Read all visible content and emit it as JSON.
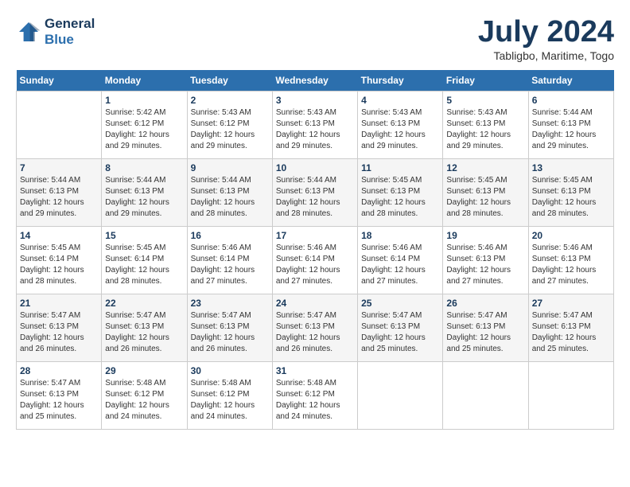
{
  "header": {
    "logo_line1": "General",
    "logo_line2": "Blue",
    "month_year": "July 2024",
    "location": "Tabligbo, Maritime, Togo"
  },
  "weekdays": [
    "Sunday",
    "Monday",
    "Tuesday",
    "Wednesday",
    "Thursday",
    "Friday",
    "Saturday"
  ],
  "weeks": [
    [
      {
        "day": "",
        "sunrise": "",
        "sunset": "",
        "daylight": ""
      },
      {
        "day": "1",
        "sunrise": "Sunrise: 5:42 AM",
        "sunset": "Sunset: 6:12 PM",
        "daylight": "Daylight: 12 hours and 29 minutes."
      },
      {
        "day": "2",
        "sunrise": "Sunrise: 5:43 AM",
        "sunset": "Sunset: 6:12 PM",
        "daylight": "Daylight: 12 hours and 29 minutes."
      },
      {
        "day": "3",
        "sunrise": "Sunrise: 5:43 AM",
        "sunset": "Sunset: 6:13 PM",
        "daylight": "Daylight: 12 hours and 29 minutes."
      },
      {
        "day": "4",
        "sunrise": "Sunrise: 5:43 AM",
        "sunset": "Sunset: 6:13 PM",
        "daylight": "Daylight: 12 hours and 29 minutes."
      },
      {
        "day": "5",
        "sunrise": "Sunrise: 5:43 AM",
        "sunset": "Sunset: 6:13 PM",
        "daylight": "Daylight: 12 hours and 29 minutes."
      },
      {
        "day": "6",
        "sunrise": "Sunrise: 5:44 AM",
        "sunset": "Sunset: 6:13 PM",
        "daylight": "Daylight: 12 hours and 29 minutes."
      }
    ],
    [
      {
        "day": "7",
        "sunrise": "Sunrise: 5:44 AM",
        "sunset": "Sunset: 6:13 PM",
        "daylight": "Daylight: 12 hours and 29 minutes."
      },
      {
        "day": "8",
        "sunrise": "Sunrise: 5:44 AM",
        "sunset": "Sunset: 6:13 PM",
        "daylight": "Daylight: 12 hours and 29 minutes."
      },
      {
        "day": "9",
        "sunrise": "Sunrise: 5:44 AM",
        "sunset": "Sunset: 6:13 PM",
        "daylight": "Daylight: 12 hours and 28 minutes."
      },
      {
        "day": "10",
        "sunrise": "Sunrise: 5:44 AM",
        "sunset": "Sunset: 6:13 PM",
        "daylight": "Daylight: 12 hours and 28 minutes."
      },
      {
        "day": "11",
        "sunrise": "Sunrise: 5:45 AM",
        "sunset": "Sunset: 6:13 PM",
        "daylight": "Daylight: 12 hours and 28 minutes."
      },
      {
        "day": "12",
        "sunrise": "Sunrise: 5:45 AM",
        "sunset": "Sunset: 6:13 PM",
        "daylight": "Daylight: 12 hours and 28 minutes."
      },
      {
        "day": "13",
        "sunrise": "Sunrise: 5:45 AM",
        "sunset": "Sunset: 6:13 PM",
        "daylight": "Daylight: 12 hours and 28 minutes."
      }
    ],
    [
      {
        "day": "14",
        "sunrise": "Sunrise: 5:45 AM",
        "sunset": "Sunset: 6:14 PM",
        "daylight": "Daylight: 12 hours and 28 minutes."
      },
      {
        "day": "15",
        "sunrise": "Sunrise: 5:45 AM",
        "sunset": "Sunset: 6:14 PM",
        "daylight": "Daylight: 12 hours and 28 minutes."
      },
      {
        "day": "16",
        "sunrise": "Sunrise: 5:46 AM",
        "sunset": "Sunset: 6:14 PM",
        "daylight": "Daylight: 12 hours and 27 minutes."
      },
      {
        "day": "17",
        "sunrise": "Sunrise: 5:46 AM",
        "sunset": "Sunset: 6:14 PM",
        "daylight": "Daylight: 12 hours and 27 minutes."
      },
      {
        "day": "18",
        "sunrise": "Sunrise: 5:46 AM",
        "sunset": "Sunset: 6:14 PM",
        "daylight": "Daylight: 12 hours and 27 minutes."
      },
      {
        "day": "19",
        "sunrise": "Sunrise: 5:46 AM",
        "sunset": "Sunset: 6:13 PM",
        "daylight": "Daylight: 12 hours and 27 minutes."
      },
      {
        "day": "20",
        "sunrise": "Sunrise: 5:46 AM",
        "sunset": "Sunset: 6:13 PM",
        "daylight": "Daylight: 12 hours and 27 minutes."
      }
    ],
    [
      {
        "day": "21",
        "sunrise": "Sunrise: 5:47 AM",
        "sunset": "Sunset: 6:13 PM",
        "daylight": "Daylight: 12 hours and 26 minutes."
      },
      {
        "day": "22",
        "sunrise": "Sunrise: 5:47 AM",
        "sunset": "Sunset: 6:13 PM",
        "daylight": "Daylight: 12 hours and 26 minutes."
      },
      {
        "day": "23",
        "sunrise": "Sunrise: 5:47 AM",
        "sunset": "Sunset: 6:13 PM",
        "daylight": "Daylight: 12 hours and 26 minutes."
      },
      {
        "day": "24",
        "sunrise": "Sunrise: 5:47 AM",
        "sunset": "Sunset: 6:13 PM",
        "daylight": "Daylight: 12 hours and 26 minutes."
      },
      {
        "day": "25",
        "sunrise": "Sunrise: 5:47 AM",
        "sunset": "Sunset: 6:13 PM",
        "daylight": "Daylight: 12 hours and 25 minutes."
      },
      {
        "day": "26",
        "sunrise": "Sunrise: 5:47 AM",
        "sunset": "Sunset: 6:13 PM",
        "daylight": "Daylight: 12 hours and 25 minutes."
      },
      {
        "day": "27",
        "sunrise": "Sunrise: 5:47 AM",
        "sunset": "Sunset: 6:13 PM",
        "daylight": "Daylight: 12 hours and 25 minutes."
      }
    ],
    [
      {
        "day": "28",
        "sunrise": "Sunrise: 5:47 AM",
        "sunset": "Sunset: 6:13 PM",
        "daylight": "Daylight: 12 hours and 25 minutes."
      },
      {
        "day": "29",
        "sunrise": "Sunrise: 5:48 AM",
        "sunset": "Sunset: 6:12 PM",
        "daylight": "Daylight: 12 hours and 24 minutes."
      },
      {
        "day": "30",
        "sunrise": "Sunrise: 5:48 AM",
        "sunset": "Sunset: 6:12 PM",
        "daylight": "Daylight: 12 hours and 24 minutes."
      },
      {
        "day": "31",
        "sunrise": "Sunrise: 5:48 AM",
        "sunset": "Sunset: 6:12 PM",
        "daylight": "Daylight: 12 hours and 24 minutes."
      },
      {
        "day": "",
        "sunrise": "",
        "sunset": "",
        "daylight": ""
      },
      {
        "day": "",
        "sunrise": "",
        "sunset": "",
        "daylight": ""
      },
      {
        "day": "",
        "sunrise": "",
        "sunset": "",
        "daylight": ""
      }
    ]
  ]
}
